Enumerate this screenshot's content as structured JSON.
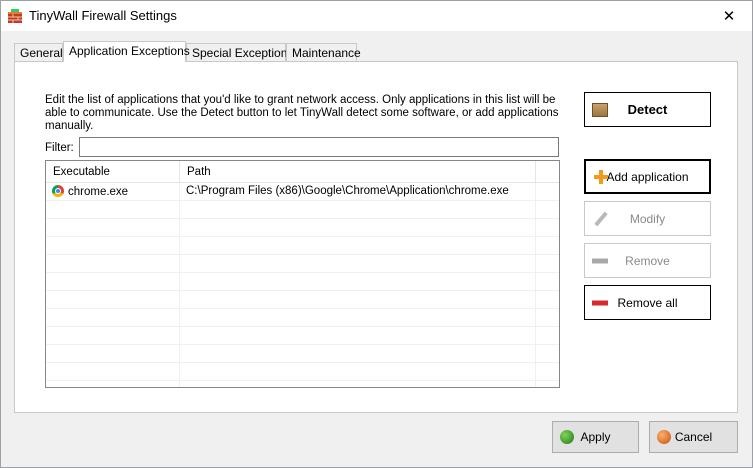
{
  "window": {
    "title": "TinyWall Firewall Settings",
    "close_glyph": "✕"
  },
  "tabs": [
    {
      "label": "General"
    },
    {
      "label": "Application Exceptions"
    },
    {
      "label": "Special Exceptions"
    },
    {
      "label": "Maintenance"
    }
  ],
  "active_tab": "Application Exceptions",
  "panel": {
    "description": "Edit the list of applications that you'd like to grant network access. Only applications in this list will be able to communicate. Use the Detect button to let TinyWall detect some software, or add applications manually.",
    "filter_label": "Filter:",
    "filter_value": ""
  },
  "list": {
    "columns": [
      "Executable",
      "Path"
    ],
    "rows": [
      {
        "executable": "chrome.exe",
        "path": "C:\\Program Files (x86)\\Google\\Chrome\\Application\\chrome.exe",
        "icon": "chrome-icon"
      }
    ]
  },
  "buttons": {
    "detect": "Detect",
    "add_application": "Add application",
    "modify": "Modify",
    "remove": "Remove",
    "remove_all": "Remove all",
    "apply": "Apply",
    "cancel": "Cancel"
  },
  "colors": {
    "add_icon": "#f39a1c",
    "remove_all_icon": "#d82a2a",
    "apply_icon": "#1f7a12",
    "cancel_icon": "#c4500f"
  }
}
